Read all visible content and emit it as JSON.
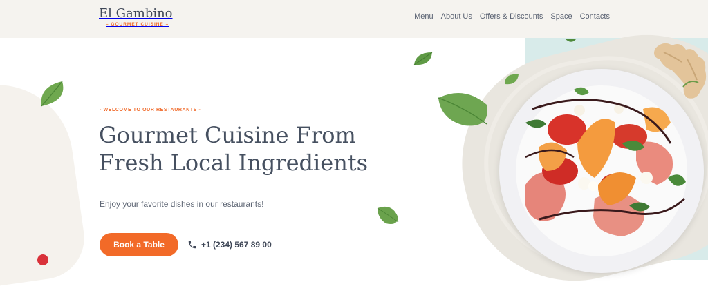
{
  "brand": {
    "name": "El Gambino",
    "tagline": "– GOURMET CUISINE –"
  },
  "nav": {
    "items": [
      {
        "label": "Menu"
      },
      {
        "label": "About Us"
      },
      {
        "label": "Offers & Discounts"
      },
      {
        "label": "Space"
      },
      {
        "label": "Contacts"
      }
    ]
  },
  "hero": {
    "eyebrow": "- WELCOME TO OUR RESTAURANTS -",
    "headline": "Gourmet Cuisine From Fresh Local Ingredients",
    "subtitle": "Enjoy your favorite dishes in our restaurants!",
    "cta_label": "Book a Table",
    "phone": "+1 (234) 567 89 00"
  },
  "colors": {
    "accent": "#f26a28",
    "header_bg": "#f5f3ef",
    "text_dark": "#465060",
    "leaf_green": "#5f9a4a"
  },
  "icons": [
    "phone-icon",
    "basil-leaf-icon"
  ]
}
